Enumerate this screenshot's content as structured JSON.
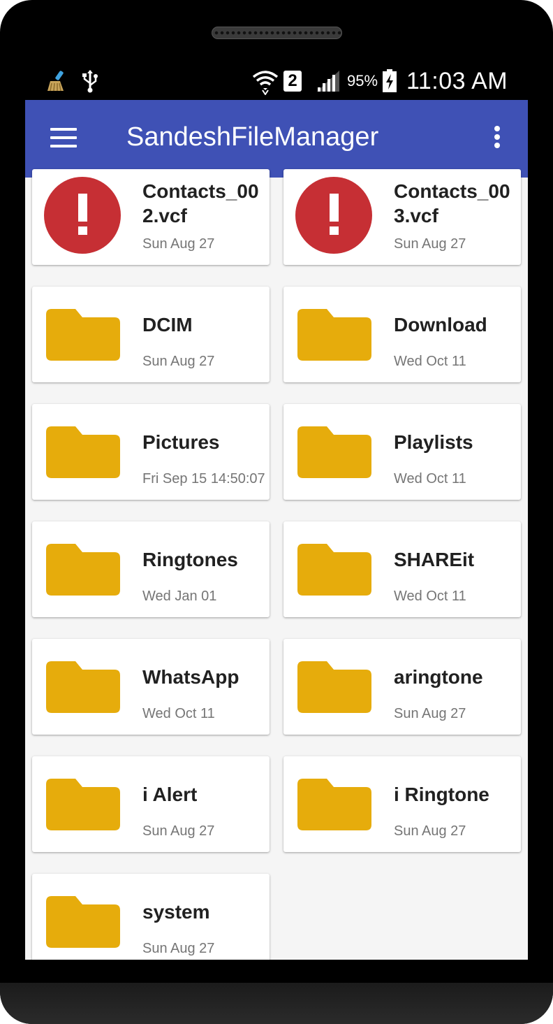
{
  "status_bar": {
    "time": "11:03 AM",
    "battery": "95%",
    "sim": "2",
    "icons": [
      "cleaner-broom-icon",
      "usb-icon",
      "wifi-icon",
      "sim-2-icon",
      "cell-signal-icon",
      "battery-charging-icon"
    ]
  },
  "app_bar": {
    "title": "SandeshFileManager",
    "menu_icon": "hamburger-menu-icon",
    "overflow_icon": "more-vert-icon"
  },
  "colors": {
    "app_bar": "#3f51b5",
    "folder": "#e6ac0c",
    "error": "#c62f34",
    "background": "#f5f5f5"
  },
  "files": [
    {
      "name": "Contacts_002.vcf",
      "date": "Sun Aug 27",
      "icon": "error-icon"
    },
    {
      "name": "Contacts_003.vcf",
      "date": "Sun Aug 27",
      "icon": "error-icon"
    },
    {
      "name": "DCIM",
      "date": "Sun Aug 27",
      "icon": "folder-icon"
    },
    {
      "name": "Download",
      "date": "Wed Oct 11",
      "icon": "folder-icon"
    },
    {
      "name": "Pictures",
      "date": "Fri Sep 15 14:50:07",
      "icon": "folder-icon"
    },
    {
      "name": "Playlists",
      "date": "Wed Oct 11",
      "icon": "folder-icon"
    },
    {
      "name": "Ringtones",
      "date": "Wed Jan 01",
      "icon": "folder-icon"
    },
    {
      "name": "SHAREit",
      "date": "Wed Oct 11",
      "icon": "folder-icon"
    },
    {
      "name": "WhatsApp",
      "date": "Wed Oct 11",
      "icon": "folder-icon"
    },
    {
      "name": "aringtone",
      "date": "Sun Aug 27",
      "icon": "folder-icon"
    },
    {
      "name": "i Alert",
      "date": "Sun Aug 27",
      "icon": "folder-icon"
    },
    {
      "name": "i Ringtone",
      "date": "Sun Aug 27",
      "icon": "folder-icon"
    },
    {
      "name": "system",
      "date": "Sun Aug 27",
      "icon": "folder-icon"
    }
  ]
}
